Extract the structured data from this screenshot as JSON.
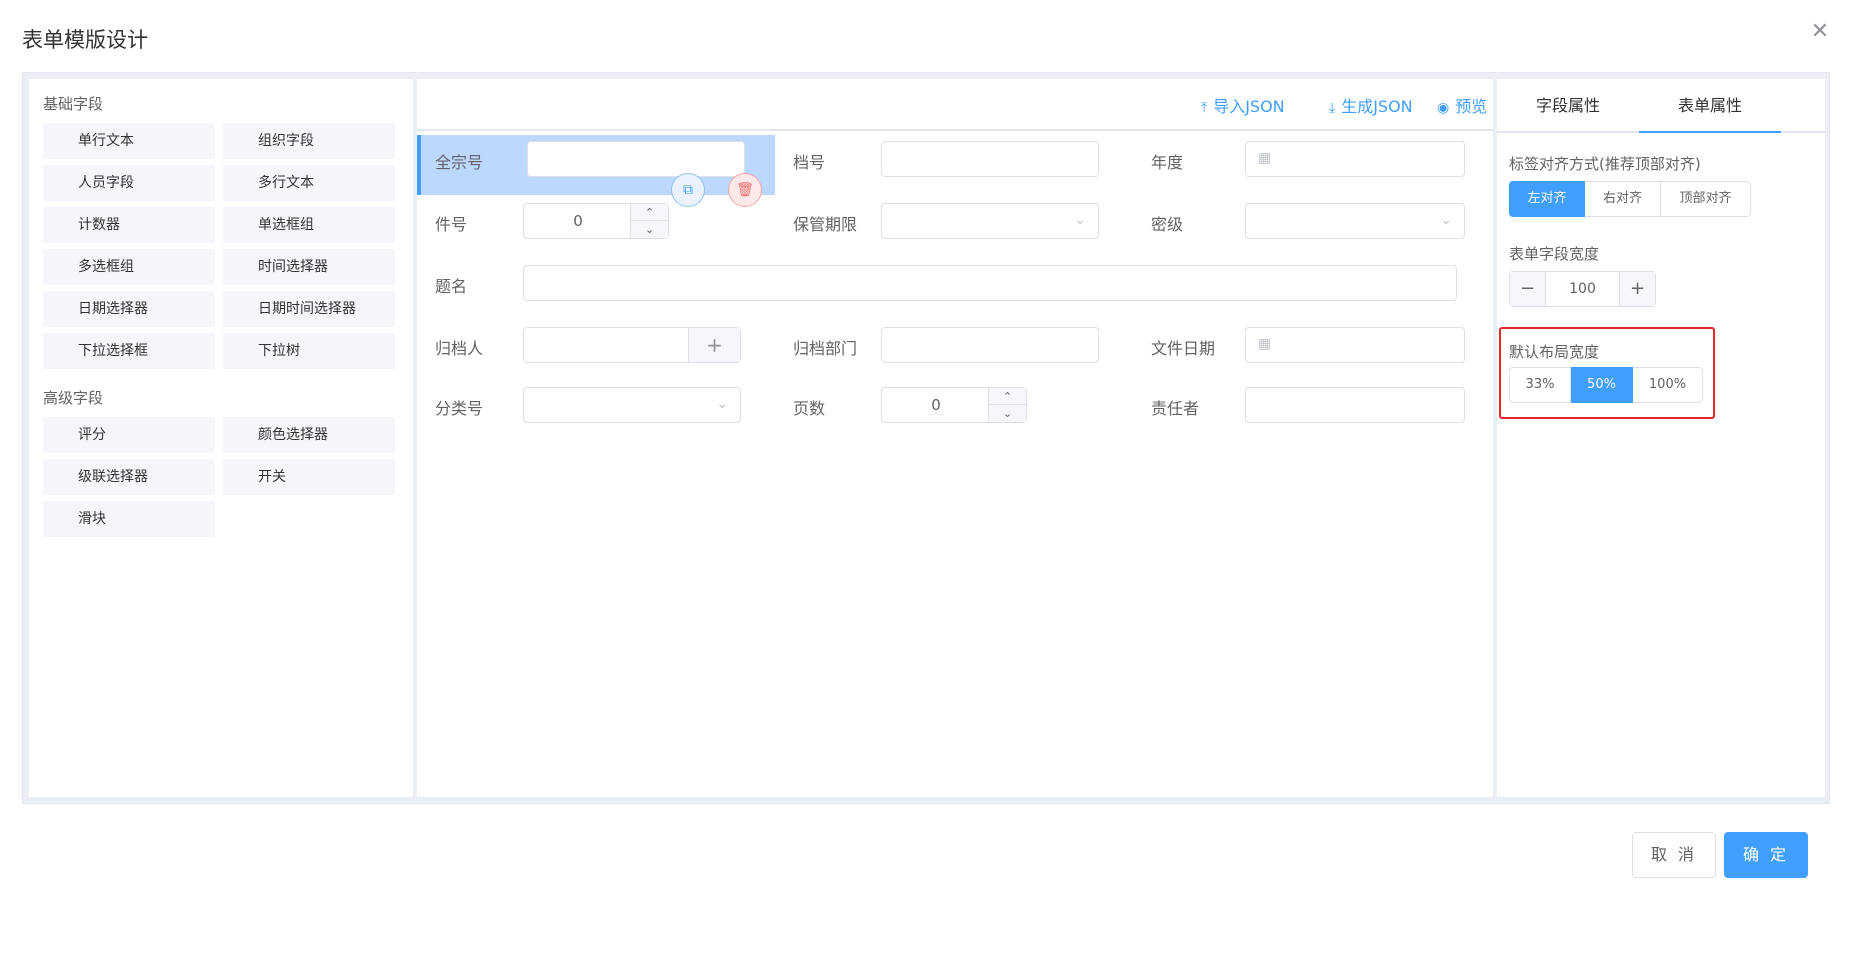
{
  "dialog": {
    "title": "表单模版设计",
    "cancel_label": "取 消",
    "confirm_label": "确 定"
  },
  "left": {
    "basic_title": "基础字段",
    "basic_items": [
      "单行文本",
      "组织字段",
      "人员字段",
      "多行文本",
      "计数器",
      "单选框组",
      "多选框组",
      "时间选择器",
      "日期选择器",
      "日期时间选择器",
      "下拉选择框",
      "下拉树"
    ],
    "advanced_title": "高级字段",
    "advanced_items": [
      "评分",
      "颜色选择器",
      "级联选择器",
      "开关",
      "滑块"
    ]
  },
  "toolbar": {
    "import_label": "导入JSON",
    "generate_label": "生成JSON",
    "preview_label": "预览"
  },
  "form": {
    "quanzonghao": "全宗号",
    "danghao": "档号",
    "niandu": "年度",
    "jianhao": "件号",
    "jianhao_value": "0",
    "baoguanqixian": "保管期限",
    "miji": "密级",
    "timing": "题名",
    "guidangren": "归档人",
    "guidangbumen": "归档部门",
    "wenjianriqi": "文件日期",
    "fenleihao": "分类号",
    "yeshu": "页数",
    "yeshu_value": "0",
    "zerenzhe": "责任者"
  },
  "right": {
    "tab_field": "字段属性",
    "tab_form": "表单属性",
    "label_align_title": "标签对齐方式(推荐顶部对齐)",
    "align_options": [
      "左对齐",
      "右对齐",
      "顶部对齐"
    ],
    "align_selected": "左对齐",
    "field_width_title": "表单字段宽度",
    "field_width_value": "100",
    "layout_width_title": "默认布局宽度",
    "layout_options": [
      "33%",
      "50%",
      "100%"
    ],
    "layout_selected": "50%"
  },
  "colors": {
    "accent": "#409eff",
    "highlight": "#e5262a",
    "selected_field": "#bcd8ff"
  }
}
